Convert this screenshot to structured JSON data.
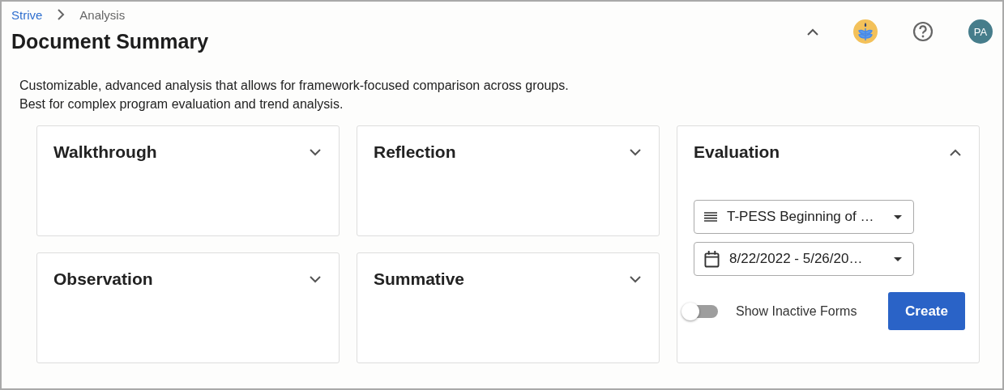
{
  "breadcrumb": [
    {
      "label": "Strive",
      "kind": "link"
    },
    {
      "label": "Analysis",
      "kind": "current"
    }
  ],
  "title": "Document Summary",
  "avatar": {
    "initials": "PA"
  },
  "description": [
    "Customizable, advanced analysis that allows for framework-focused comparison across groups.",
    "Best for complex program evaluation and trend analysis."
  ],
  "cards": [
    {
      "title": "Walkthrough",
      "expanded": false
    },
    {
      "title": "Reflection",
      "expanded": false
    },
    {
      "title": "Evaluation",
      "expanded": true
    },
    {
      "title": "Observation",
      "expanded": false
    },
    {
      "title": "Summative",
      "expanded": false
    }
  ],
  "evaluation": {
    "form_select": {
      "value": "T-PESS Beginning of …"
    },
    "date_select": {
      "value": "8/22/2022 - 5/26/20…"
    },
    "show_inactive": {
      "label": "Show Inactive Forms",
      "on": false
    },
    "create_button": "Create"
  }
}
